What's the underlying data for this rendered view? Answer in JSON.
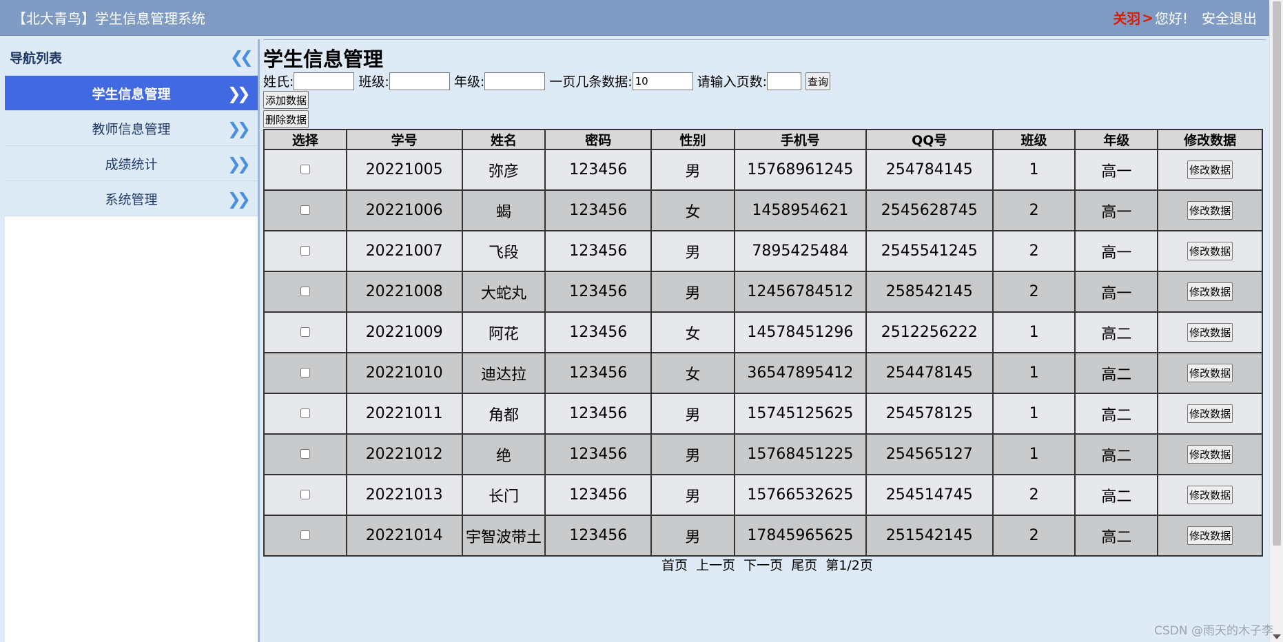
{
  "header": {
    "title": "【北大青鸟】学生信息管理系统",
    "user_name": "关羽",
    "user_arrow": ">",
    "greeting": "您好!",
    "logout": "安全退出"
  },
  "sidebar": {
    "title": "导航列表",
    "items": [
      {
        "label": "学生信息管理",
        "active": true
      },
      {
        "label": "教师信息管理",
        "active": false
      },
      {
        "label": "成绩统计",
        "active": false
      },
      {
        "label": "系统管理",
        "active": false
      }
    ]
  },
  "main": {
    "page_title": "学生信息管理",
    "filters": {
      "surname_label": "姓氏:",
      "surname_value": "",
      "class_label": "班级:",
      "class_value": "",
      "grade_label": "年级:",
      "grade_value": "",
      "page_size_label": "一页几条数据:",
      "page_size_value": "10",
      "page_num_label": "请输入页数:",
      "page_num_value": "",
      "query_button": "查询"
    },
    "add_button": "添加数据",
    "delete_button": "删除数据",
    "table": {
      "headers": [
        "选择",
        "学号",
        "姓名",
        "密码",
        "性别",
        "手机号",
        "QQ号",
        "班级",
        "年级",
        "修改数据"
      ],
      "edit_label": "修改数据",
      "rows": [
        [
          "20221005",
          "弥彦",
          "123456",
          "男",
          "15768961245",
          "254784145",
          "1",
          "高一"
        ],
        [
          "20221006",
          "蝎",
          "123456",
          "女",
          "1458954621",
          "2545628745",
          "2",
          "高一"
        ],
        [
          "20221007",
          "飞段",
          "123456",
          "男",
          "7895425484",
          "2545541245",
          "2",
          "高一"
        ],
        [
          "20221008",
          "大蛇丸",
          "123456",
          "男",
          "12456784512",
          "258542145",
          "2",
          "高一"
        ],
        [
          "20221009",
          "阿花",
          "123456",
          "女",
          "14578451296",
          "2512256222",
          "1",
          "高二"
        ],
        [
          "20221010",
          "迪达拉",
          "123456",
          "女",
          "36547895412",
          "254478145",
          "1",
          "高二"
        ],
        [
          "20221011",
          "角都",
          "123456",
          "男",
          "15745125625",
          "254578125",
          "1",
          "高二"
        ],
        [
          "20221012",
          "绝",
          "123456",
          "男",
          "15768451225",
          "254565127",
          "1",
          "高二"
        ],
        [
          "20221013",
          "长门",
          "123456",
          "男",
          "15766532625",
          "254514745",
          "2",
          "高二"
        ],
        [
          "20221014",
          "宇智波带土",
          "123456",
          "男",
          "17845965625",
          "251542145",
          "2",
          "高二"
        ]
      ]
    },
    "pager": {
      "first": "首页",
      "prev": "上一页",
      "next": "下一页",
      "last": "尾页",
      "info": "第1/2页"
    }
  },
  "watermark": "CSDN @雨天的木子李",
  "colors": {
    "header_bg": "#7f9bc4",
    "active_nav": "#4169e1",
    "user_name": "#d81e06",
    "page_bg": "#dfeaf7"
  }
}
